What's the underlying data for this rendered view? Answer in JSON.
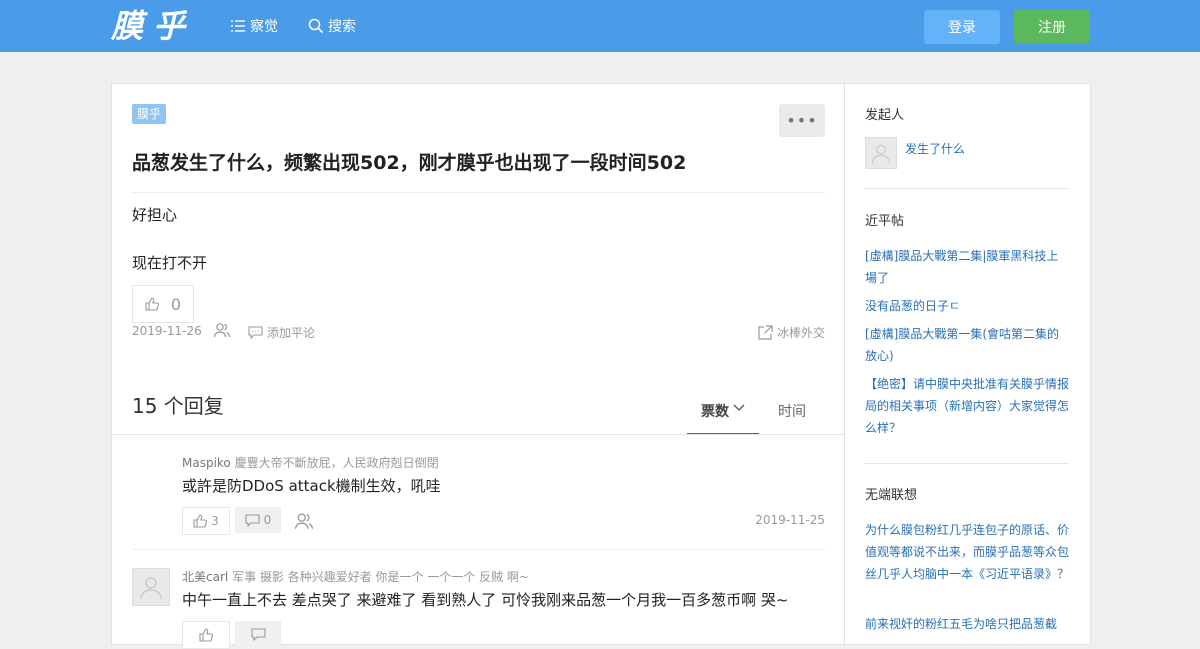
{
  "header": {
    "logo": "膜乎",
    "nav": [
      {
        "label": "察觉",
        "icon": "list-icon"
      },
      {
        "label": "搜索",
        "icon": "search-icon"
      }
    ],
    "login_label": "登录",
    "register_label": "注册",
    "colors": {
      "bar": "#4a9be8",
      "login": "#64b2f8",
      "register": "#5cb85c"
    }
  },
  "post": {
    "tag": "膜乎",
    "title": "品葱发生了什么，频繁出现502，刚才膜乎也出现了一段时间502",
    "body": [
      "好担心",
      "现在打不开"
    ],
    "like_count": "0",
    "date": "2019-11-26",
    "add_comment_label": "添加平论",
    "share_label": "冰棒外交"
  },
  "replies": {
    "count_label": "15 个回复",
    "sort_votes": "票数",
    "sort_time": "时间",
    "items": [
      {
        "author": "Maspiko",
        "bio": "慶豐大帝不斷放屁，人民政府剋日倒閉",
        "text": "或許是防DDoS attack機制生效，吼哇",
        "likes": "3",
        "comments": "0",
        "date": "2019-11-25"
      },
      {
        "author": "北美carl",
        "bio": "军事 摄影 各种兴趣爱好者 你是一个 一个一个 反贼 啊~",
        "text": "中午一直上不去 差点哭了 来避难了 看到熟人了 可怜我刚来品葱一个月我一百多葱币啊 哭~",
        "likes": "",
        "comments": "",
        "date": ""
      }
    ]
  },
  "sidebar": {
    "initiator_heading": "发起人",
    "initiator_name": "发生了什么",
    "recent_heading": "近平帖",
    "recent_links": [
      "[虛構]膜品大戰第二集|膜軍黑科技上場了",
      "没有品葱的日子ㄷ",
      "[虛構]膜品大戰第一集(會咕第二集的放心)",
      "【绝密】请中膜中央批准有关膜乎情报局的相关事项（新增内容）大家觉得怎么样？"
    ],
    "related_heading": "无端联想",
    "related_links": [
      "为什么膜包粉红几乎连包子的原话、价值观等都说不出来，而膜乎品葱等众包丝几乎人均脑中一本《习近平语录》？",
      "前来视奸的粉红五毛为啥只把品葱截"
    ]
  }
}
